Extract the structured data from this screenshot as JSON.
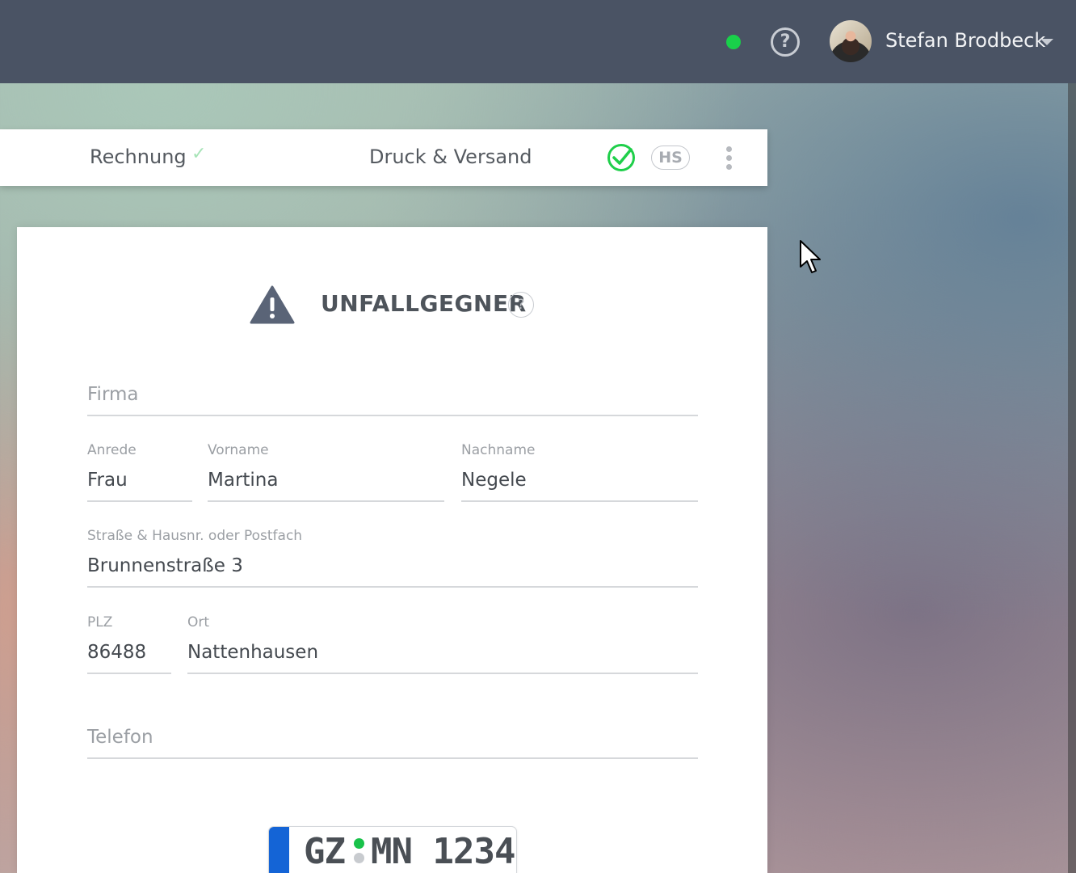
{
  "header": {
    "status_color": "#19d04a",
    "help_label": "?",
    "user_name": "Stefan Brodbeck"
  },
  "tabs": {
    "rechnung": "Rechnung",
    "rechnung_check": "✓",
    "druck": "Druck & Versand",
    "badge": "HS"
  },
  "card": {
    "title": "UNFALLGEGNER",
    "help_label": "?",
    "firma_placeholder": "Firma",
    "anrede_label": "Anrede",
    "anrede_value": "Frau",
    "vorname_label": "Vorname",
    "vorname_value": "Martina",
    "nachname_label": "Nachname",
    "nachname_value": "Negele",
    "strasse_label": "Straße & Hausnr. oder Postfach",
    "strasse_value": "Brunnenstraße 3",
    "plz_label": "PLZ",
    "plz_value": "86488",
    "ort_label": "Ort",
    "ort_value": "Nattenhausen",
    "telefon_placeholder": "Telefon"
  },
  "plate": {
    "left": "GZ",
    "right": "MN 1234"
  }
}
